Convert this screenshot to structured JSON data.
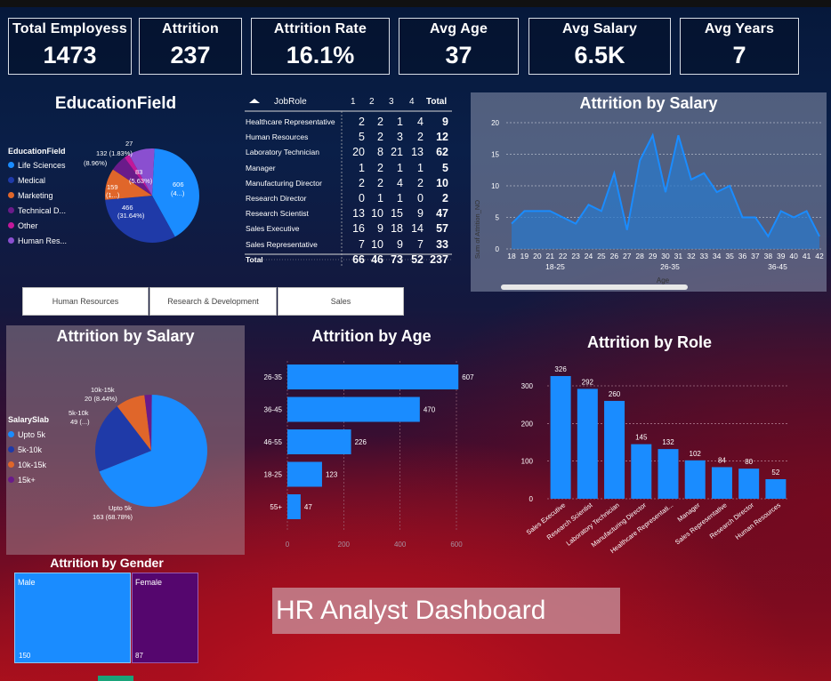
{
  "kpis": [
    {
      "title": "Total Employess",
      "value": "1473"
    },
    {
      "title": "Attrition",
      "value": "237"
    },
    {
      "title": "Attrition Rate",
      "value": "16.1%"
    },
    {
      "title": "Avg Age",
      "value": "37"
    },
    {
      "title": "Avg Salary",
      "value": "6.5K"
    },
    {
      "title": "Avg Years",
      "value": "7"
    }
  ],
  "education": {
    "title": "EducationField",
    "legend_title": "EducationField",
    "legend": [
      "Life Sciences",
      "Medical",
      "Marketing",
      "Technical D...",
      "Other",
      "Human Res..."
    ],
    "labels": {
      "tech": "132 (1.83%)",
      "tech_pct": "(8.96%)",
      "other": "27",
      "mkt1": "83",
      "mkt2": "(5.63%)",
      "hr1": "159",
      "hr2": "(1...)",
      "med1": "466",
      "med2": "(31.64%)",
      "life1": "606",
      "life2": "(4...)"
    }
  },
  "matrix": {
    "headers": [
      "JobRole",
      "1",
      "2",
      "3",
      "4",
      "Total"
    ],
    "rows": [
      {
        "role": "Healthcare Representative",
        "v": [
          "2",
          "2",
          "1",
          "4"
        ],
        "total": "9"
      },
      {
        "role": "Human Resources",
        "v": [
          "5",
          "2",
          "3",
          "2"
        ],
        "total": "12"
      },
      {
        "role": "Laboratory Technician",
        "v": [
          "20",
          "8",
          "21",
          "13"
        ],
        "total": "62"
      },
      {
        "role": "Manager",
        "v": [
          "1",
          "2",
          "1",
          "1"
        ],
        "total": "5"
      },
      {
        "role": "Manufacturing Director",
        "v": [
          "2",
          "2",
          "4",
          "2"
        ],
        "total": "10"
      },
      {
        "role": "Research Director",
        "v": [
          "0",
          "1",
          "1",
          "0"
        ],
        "total": "2"
      },
      {
        "role": "Research Scientist",
        "v": [
          "13",
          "10",
          "15",
          "9"
        ],
        "total": "47"
      },
      {
        "role": "Sales Executive",
        "v": [
          "16",
          "9",
          "18",
          "14"
        ],
        "total": "57"
      },
      {
        "role": "Sales Representative",
        "v": [
          "7",
          "10",
          "9",
          "7"
        ],
        "total": "33"
      }
    ],
    "total_row": {
      "role": "Total",
      "v": [
        "66",
        "46",
        "73",
        "52"
      ],
      "total": "237"
    }
  },
  "salary_line": {
    "title": "Attrition by Salary",
    "ylabel": "Sum of Attrition_NO",
    "xlabel": "Age",
    "groups": [
      "18-25",
      "26-35",
      "36-45"
    ]
  },
  "filters": [
    "Human Resources",
    "Research & Development",
    "Sales"
  ],
  "salary_pie": {
    "title": "Attrition by Salary",
    "legend_title": "SalarySlab",
    "legend": [
      "Upto 5k",
      "5k-10k",
      "10k-15k",
      "15k+"
    ],
    "labels": {
      "a1": "10k-15k",
      "a2": "20 (8.44%)",
      "b1": "5k-10k",
      "b2": "49 (...)",
      "c1": "Upto 5k",
      "c2": "163 (68.78%)"
    }
  },
  "age_title": "Attrition by Age",
  "role_title": "Attrition by Role",
  "gender": {
    "title": "Attrition by Gender",
    "items": [
      {
        "label": "Male",
        "value": "150"
      },
      {
        "label": "Female",
        "value": "87"
      }
    ]
  },
  "dashboard_title": "HR Analyst Dashboard",
  "colors": {
    "primary": "#1a8cff",
    "navy": "#1f3aa8",
    "orange": "#e0662a",
    "purple": "#6a1b8a",
    "magenta": "#c2189a",
    "gender_female": "#55066e"
  },
  "chart_data": [
    {
      "type": "area",
      "title": "Attrition by Salary",
      "ylabel": "Sum of Attrition_NO",
      "xlabel": "Age",
      "x": [
        18,
        19,
        20,
        21,
        22,
        23,
        24,
        25,
        26,
        27,
        28,
        29,
        30,
        31,
        32,
        33,
        34,
        35,
        36,
        37,
        38,
        39,
        40,
        41,
        42
      ],
      "y": [
        4,
        6,
        6,
        6,
        5,
        4,
        7,
        6,
        12,
        3,
        14,
        18,
        9,
        18,
        11,
        12,
        9,
        10,
        5,
        5,
        2,
        6,
        5,
        6,
        2
      ],
      "ylim": [
        0,
        20
      ],
      "yticks": [
        0,
        5,
        10,
        15,
        20
      ]
    },
    {
      "type": "bar",
      "orientation": "horizontal",
      "title": "Attrition by Age",
      "categories": [
        "26-35",
        "36-45",
        "46-55",
        "18-25",
        "55+"
      ],
      "values": [
        607,
        470,
        226,
        123,
        47
      ],
      "xlim": [
        0,
        600
      ],
      "xticks": [
        0,
        200,
        400,
        600
      ]
    },
    {
      "type": "bar",
      "title": "Attrition by Role",
      "categories": [
        "Sales Executive",
        "Research Scientist",
        "Laboratory Technician",
        "Manufacturing Director",
        "Healthcare Representati...",
        "Manager",
        "Sales Representative",
        "Research Director",
        "Human Resources"
      ],
      "values": [
        326,
        292,
        260,
        145,
        132,
        102,
        84,
        80,
        52
      ],
      "ylim": [
        0,
        300
      ],
      "yticks": [
        0,
        100,
        200,
        300
      ]
    },
    {
      "type": "pie",
      "title": "Attrition by Salary",
      "categories": [
        "Upto 5k",
        "5k-10k",
        "10k-15k",
        "15k+"
      ],
      "values": [
        163,
        49,
        20,
        5
      ]
    },
    {
      "type": "pie",
      "title": "EducationField",
      "categories": [
        "Life Sciences",
        "Medical",
        "Human Res...",
        "Marketing",
        "Other",
        "Technical D..."
      ],
      "values": [
        606,
        466,
        159,
        83,
        27,
        132
      ]
    }
  ]
}
